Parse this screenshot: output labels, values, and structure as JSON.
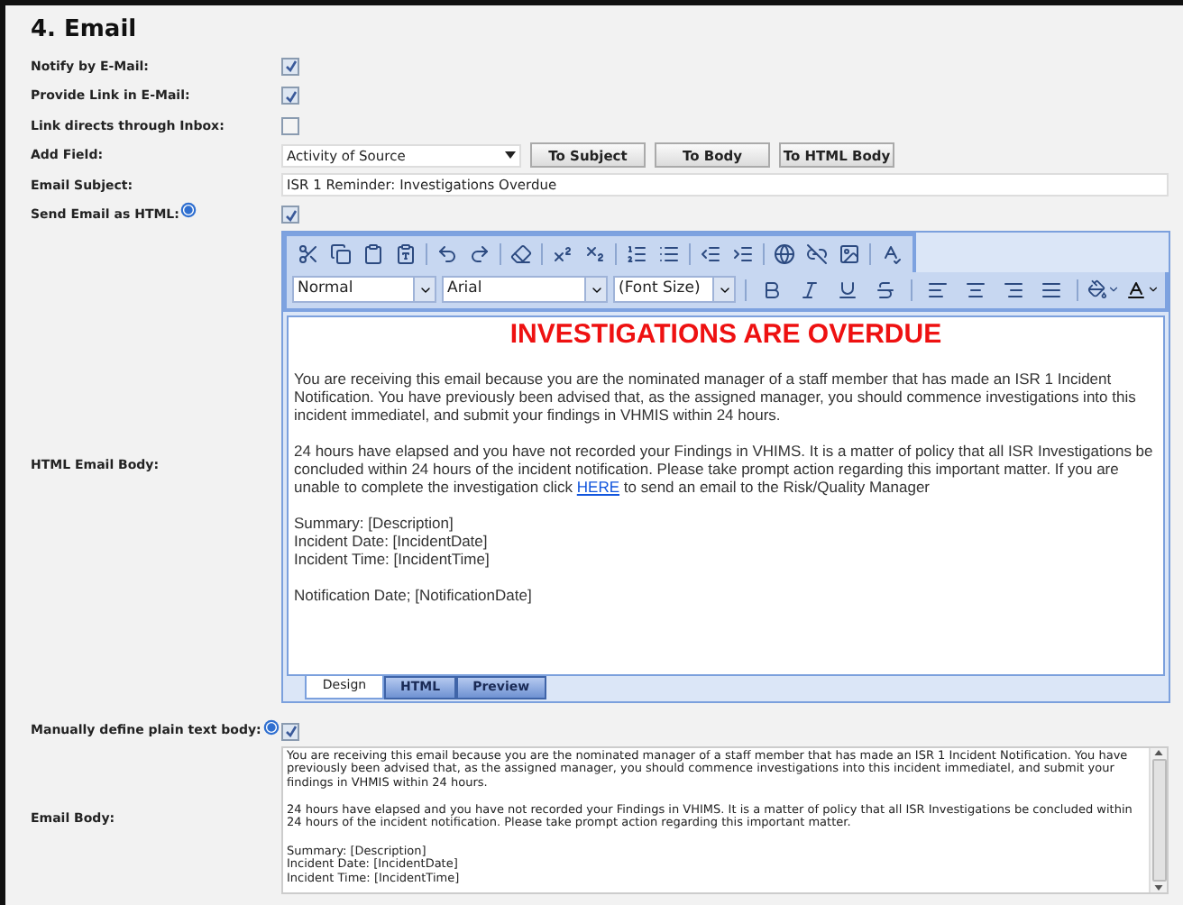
{
  "section_title": "4. Email",
  "fields": [
    {
      "kind": "checkbox",
      "label": "Notify by E-Mail:",
      "checked": true
    },
    {
      "kind": "checkbox",
      "label": "Provide Link in E-Mail:",
      "checked": true
    },
    {
      "kind": "checkbox",
      "label": "Link directs through Inbox:",
      "checked": false
    },
    {
      "kind": "add_field",
      "label": "Add Field:",
      "value": "Activity of Source",
      "buttons": [
        "To Subject",
        "To Body",
        "To HTML Body"
      ]
    },
    {
      "kind": "text",
      "label": "Email Subject:",
      "value": "ISR 1 Reminder: Investigations Overdue"
    },
    {
      "kind": "checkbox",
      "label": "Send Email as HTML:",
      "help": true,
      "checked": true
    }
  ],
  "html_body": {
    "label": "HTML Email Body:",
    "style_select": "Normal",
    "font_select": "Arial",
    "size_select": "(Font Size)",
    "heading": "INVESTIGATIONS ARE OVERDUE",
    "paragraphs": [
      {
        "text": "You are receiving this email because you are the nominated manager of a staff member that has made an ISR 1 Incident Notification. You have previously been advised that, as the assigned manager, you should commence investigations into this incident immediatel, and submit your findings in VHMIS within 24 hours."
      },
      {
        "text": "24 hours have elapsed and you have not recorded your Findings in VHIMS. It is a matter of policy that all ISR Investigations be concluded within 24 hours of the incident notification. Please take prompt action regarding this important matter. If you are unable to complete the investigation click",
        "link": "HERE",
        "after": "to send an email to the Risk/Quality Manager"
      }
    ],
    "lines": [
      "Summary: [Description]",
      "Incident Date: [IncidentDate]",
      "Incident Time: [IncidentTime]"
    ],
    "footer_line": "Notification Date; [NotificationDate]",
    "tabs": [
      {
        "label": "Design",
        "selected": true
      },
      {
        "label": "HTML",
        "selected": false
      },
      {
        "label": "Preview",
        "selected": false
      }
    ]
  },
  "plain_toggle": {
    "label": "Manually define plain text body:",
    "help": true,
    "checked": true
  },
  "plain_body": {
    "label": "Email Body:",
    "paragraphs": [
      "You are receiving this email because you are the nominated manager of a staff member that has made an ISR 1 Incident Notification. You have previously been advised that, as the assigned manager, you should commence investigations into this incident immediatel, and submit your findings in VHMIS within 24 hours.",
      "24 hours have elapsed and you have not recorded your Findings in VHIMS. It is a matter of policy that all ISR Investigations be concluded within 24 hours of the incident notification. Please take prompt action regarding this important matter."
    ],
    "lines": [
      "Summary: [Description]",
      "Incident Date: [IncidentDate]",
      "Incident Time: [IncidentTime]"
    ]
  }
}
